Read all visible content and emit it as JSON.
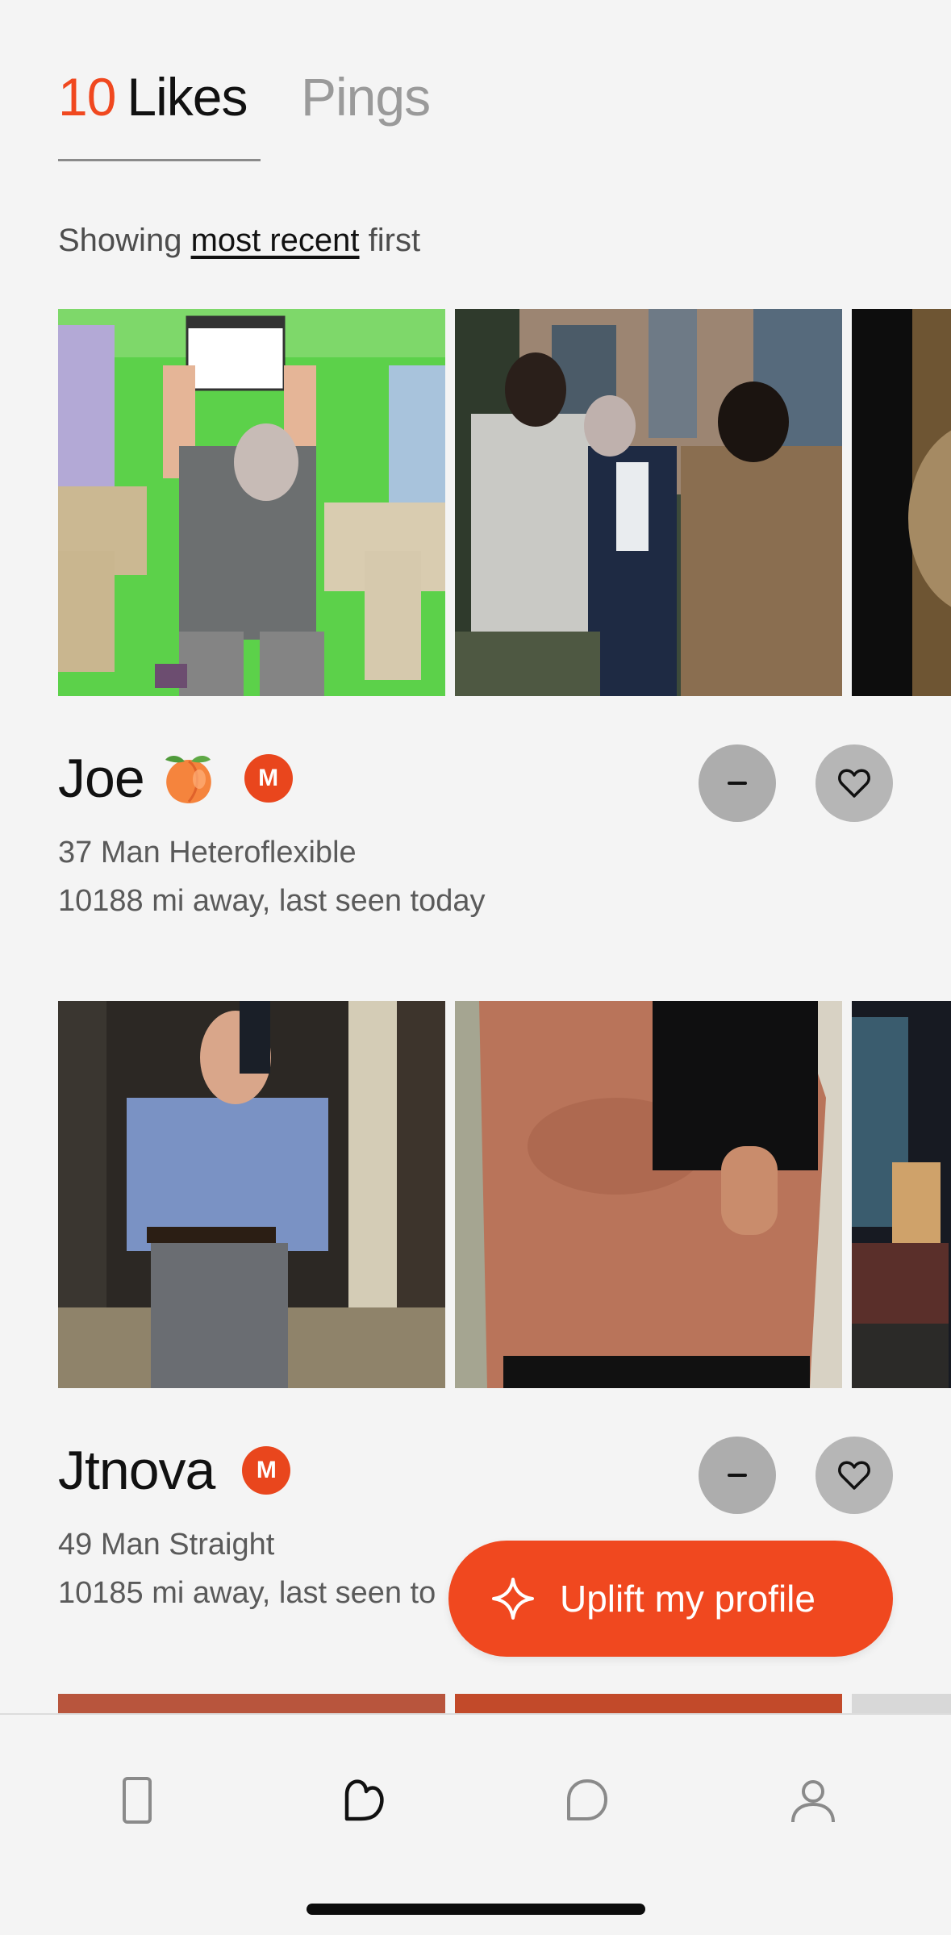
{
  "tabs": {
    "likes_count": "10",
    "likes_label": "Likes",
    "pings_label": "Pings"
  },
  "sort": {
    "prefix": "Showing",
    "option": "most recent",
    "suffix": "first"
  },
  "profiles": [
    {
      "name": "Joe",
      "emoji_icon": "peach-icon",
      "badge": "M",
      "line1": "37 Man Heteroflexible",
      "line2": "10188 mi away, last seen today"
    },
    {
      "name": "Jtnova",
      "badge": "M",
      "line1": "49 Man Straight",
      "line2": "10185 mi away, last seen to"
    }
  ],
  "uplift_button": {
    "label": "Uplift my profile",
    "icon": "sparkle-icon"
  },
  "bottom_nav": [
    {
      "icon": "card-stack-icon",
      "active": false
    },
    {
      "icon": "likes-icon",
      "active": true
    },
    {
      "icon": "chat-icon",
      "active": false
    },
    {
      "icon": "profile-icon",
      "active": false
    }
  ],
  "colors": {
    "accent": "#f0481f",
    "background": "#f4f4f4",
    "inactive_tab": "#9a9a9a"
  }
}
